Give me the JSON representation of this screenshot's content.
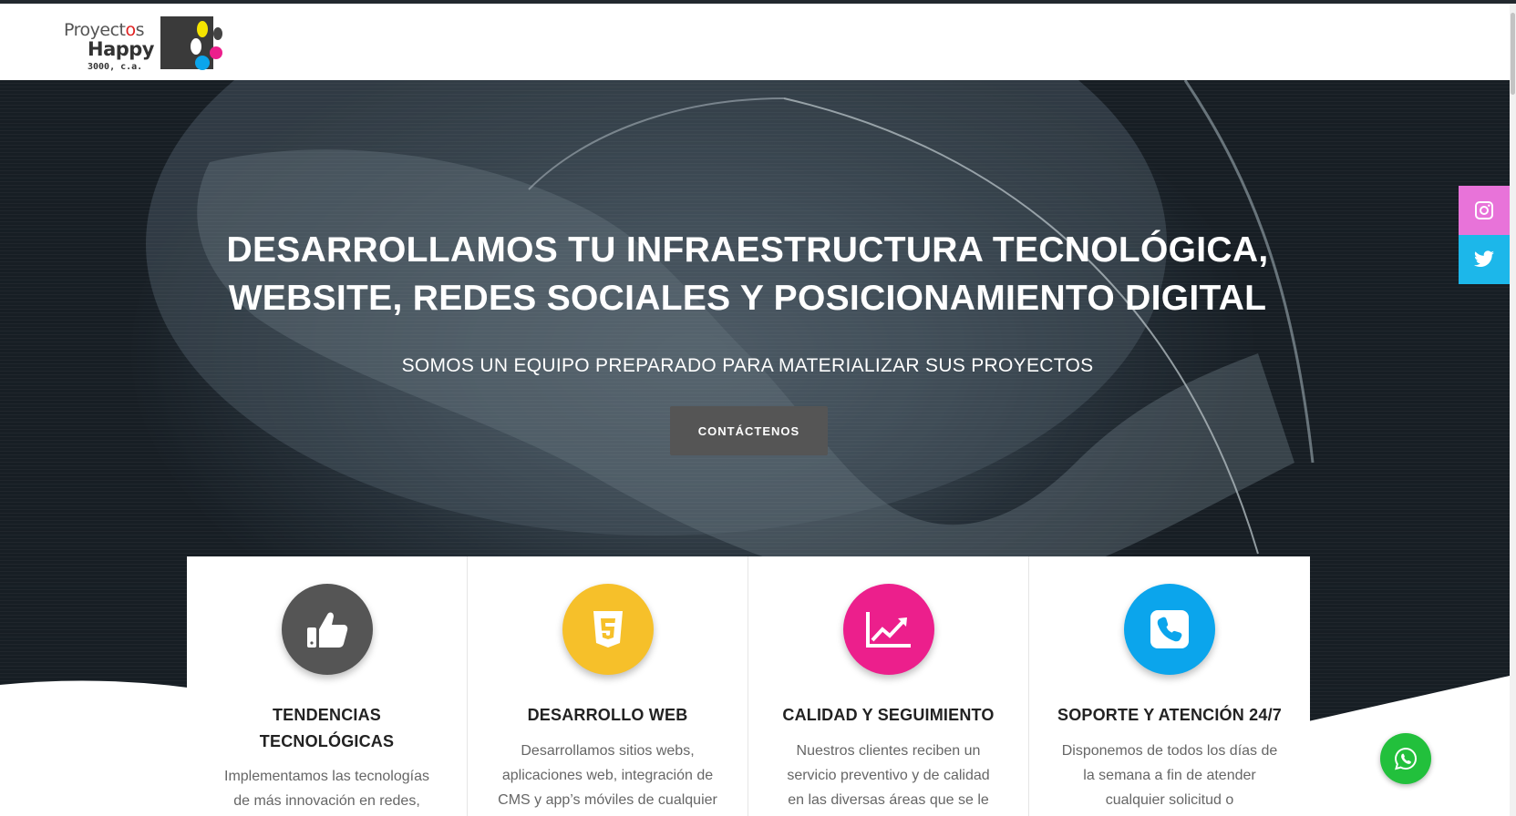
{
  "brand": {
    "line1_prefix": "Proyect",
    "line1_o": "o",
    "line1_suffix": "s",
    "line2": "Happy",
    "line3": "3000, c.a."
  },
  "hero": {
    "headline_line1": "DESARROLLAMOS TU INFRAESTRUCTURA TECNOLÓGICA,",
    "headline_line2": "WEBSITE, REDES SOCIALES Y POSICIONAMIENTO DIGITAL",
    "subline": "SOMOS UN EQUIPO PREPARADO PARA MATERIALIZAR SUS PROYECTOS",
    "cta_label": "CONTÁCTENOS"
  },
  "social": [
    {
      "name": "instagram",
      "icon": "instagram-icon",
      "color": "#e873d9"
    },
    {
      "name": "twitter",
      "icon": "twitter-icon",
      "color": "#1cb7ea"
    }
  ],
  "services": [
    {
      "icon": "thumbs-up-icon",
      "color": "#555555",
      "title_line1": "TENDENCIAS",
      "title_line2": "TECNOLÓGICAS",
      "text_line1": "Implementamos las tecnologías",
      "text_line2": "de más innovación en redes,"
    },
    {
      "icon": "html5-icon",
      "color": "#f6c02a",
      "title": "DESARROLLO WEB",
      "text_line1": "Desarrollamos sitios webs,",
      "text_line2": "aplicaciones web, integración de",
      "text_line3": "CMS y app’s móviles de cualquier"
    },
    {
      "icon": "chart-line-icon",
      "color": "#ec1f8c",
      "title": "CALIDAD Y SEGUIMIENTO",
      "text_line1": "Nuestros clientes reciben un",
      "text_line2": "servicio preventivo y de calidad",
      "text_line3": "en las diversas áreas que se le"
    },
    {
      "icon": "phone-icon",
      "color": "#0ba5ec",
      "title": "SOPORTE Y ATENCIÓN 24/7",
      "text_line1": "Disponemos de todos los días de",
      "text_line2": "la semana a fin de atender",
      "text_line3": "cualquier solicitud o"
    }
  ],
  "whatsapp": {
    "icon": "whatsapp-icon",
    "color": "#22c03c"
  }
}
